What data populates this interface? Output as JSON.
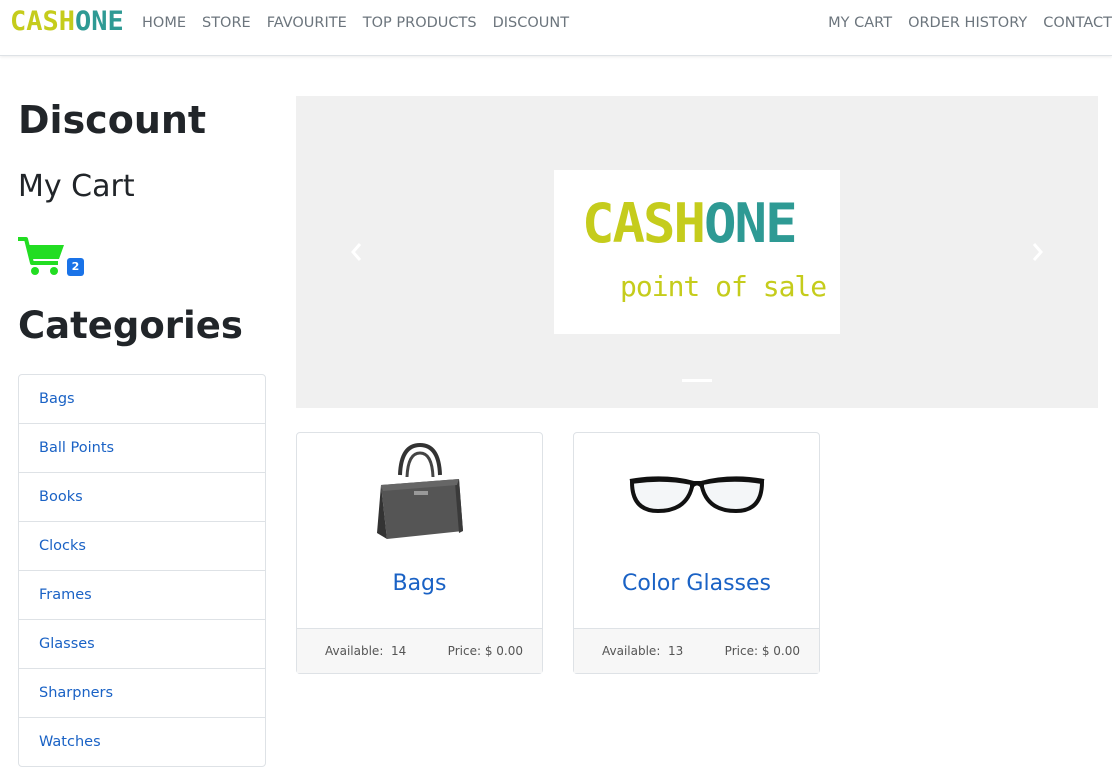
{
  "brand": {
    "part1": "CASH",
    "part2": "ONE"
  },
  "nav": {
    "left": [
      "HOME",
      "STORE",
      "FAVOURITE",
      "TOP PRODUCTS",
      "DISCOUNT"
    ],
    "right": [
      "MY CART",
      "ORDER HISTORY",
      "CONTACT"
    ]
  },
  "sidebar": {
    "discount_heading": "Discount",
    "mycart_heading": "My Cart",
    "cart_count": "2",
    "categories_heading": "Categories",
    "categories": [
      "Bags",
      "Ball Points",
      "Books",
      "Clocks",
      "Frames",
      "Glasses",
      "Sharpners",
      "Watches"
    ]
  },
  "carousel": {
    "logo_part1": "CASH",
    "logo_part2": "ONE",
    "logo_tagline": "point of sale"
  },
  "products": [
    {
      "name": "Bags",
      "available_label": "Available:",
      "available": "14",
      "price_label": "Price:",
      "price": "$ 0.00",
      "icon": "handbag-icon"
    },
    {
      "name": "Color Glasses",
      "available_label": "Available:",
      "available": "13",
      "price_label": "Price:",
      "price": "$ 0.00",
      "icon": "glasses-icon"
    }
  ],
  "colors": {
    "brand_yellow": "#c5cc1c",
    "brand_teal": "#2e9a94",
    "link_blue": "#1a62c5",
    "cart_green": "#22dd22",
    "badge_blue": "#1a73e8"
  }
}
